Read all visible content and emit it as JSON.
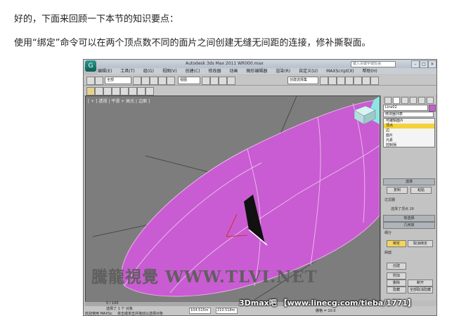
{
  "intro": "好的，下面来回顾一下本节的知识要点：",
  "summary": "使用“绑定”命令可以在两个顶点数不同的面片之间创建无缝无间距的连接，修补撕裂面。",
  "app": {
    "title": "Autodesk 3ds Max  2011      WR000.max",
    "search_placeholder": "键入关键字或短语",
    "menus": [
      "编辑(E)",
      "工具(T)",
      "组(G)",
      "视图(V)",
      "创建(C)",
      "修改器",
      "动画",
      "图形编辑器",
      "渲染(R)",
      "自定义(U)",
      "MAXScript(X)",
      "帮助(H)"
    ],
    "toolbar": {
      "selection_filter": "全部",
      "view_dropdown": "视图",
      "named_selection": "创建选择集"
    },
    "viewport": {
      "label": "[ + ] 透视 | 平滑 + 高光 | 边面 ]",
      "watermark": "騰龍視覺 WWW.TLVI.NET"
    },
    "panel": {
      "object_name": "Line02",
      "modifier_list": "修改器列表",
      "stack": [
        "可编辑面片",
        "顶点",
        "边",
        "面片",
        "元素",
        "控制柄"
      ],
      "selection_header": "选择",
      "btn_named_copy": "复制",
      "btn_named_paste": "粘贴",
      "filter_label": "过滤器",
      "info": "选择了顶点 26",
      "soft_selection": "软选择",
      "geometry": "几何体",
      "subdivision_label": "细分",
      "btn_bind": "绑定",
      "btn_unbind": "取消绑定",
      "surface_label": "曲面",
      "btn_create": "创建",
      "btn_attach": "附加",
      "btn_delete": "删除",
      "btn_break": "断开",
      "btn_hide": "隐藏",
      "btn_unhide_all": "全部取消隐藏"
    },
    "status": {
      "frame": "0 / 100",
      "selected": "选择了 1 个 对象",
      "welcome": "欢迎使用 MAXSc",
      "prompt": "单击或单击并拖动以选择对象",
      "x": "104.515m",
      "y": "210.518m",
      "grid": "栅格 = 10.0"
    }
  },
  "credit": "3Dmax吧 【www.linecg.com/tieba/1771】"
}
